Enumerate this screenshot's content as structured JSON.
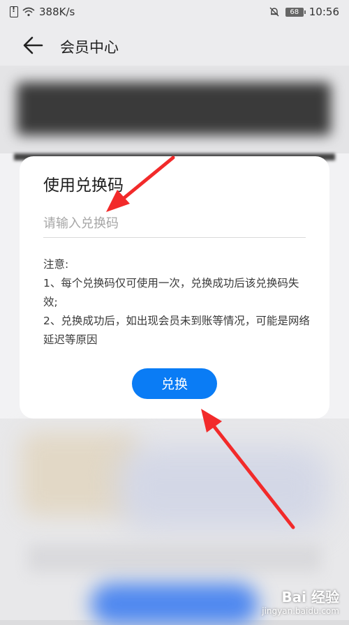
{
  "status_bar": {
    "network_speed": "388K/s",
    "battery": "68",
    "time": "10:56"
  },
  "header": {
    "title": "会员中心"
  },
  "dialog": {
    "title": "使用兑换码",
    "input": {
      "placeholder": "请输入兑换码",
      "value": ""
    },
    "notice": {
      "heading": "注意:",
      "line1": "1、每个兑换码仅可使用一次，兑换成功后该兑换码失效;",
      "line2": "2、兑换成功后，如出现会员未到账等情况，可能是网络延迟等原因"
    },
    "button_label": "兑换"
  },
  "watermark": {
    "brand": "Bai 经验",
    "url": "jingyan.baidu.com"
  },
  "colors": {
    "accent": "#0a7cf5",
    "arrow": "#f22a2a"
  }
}
